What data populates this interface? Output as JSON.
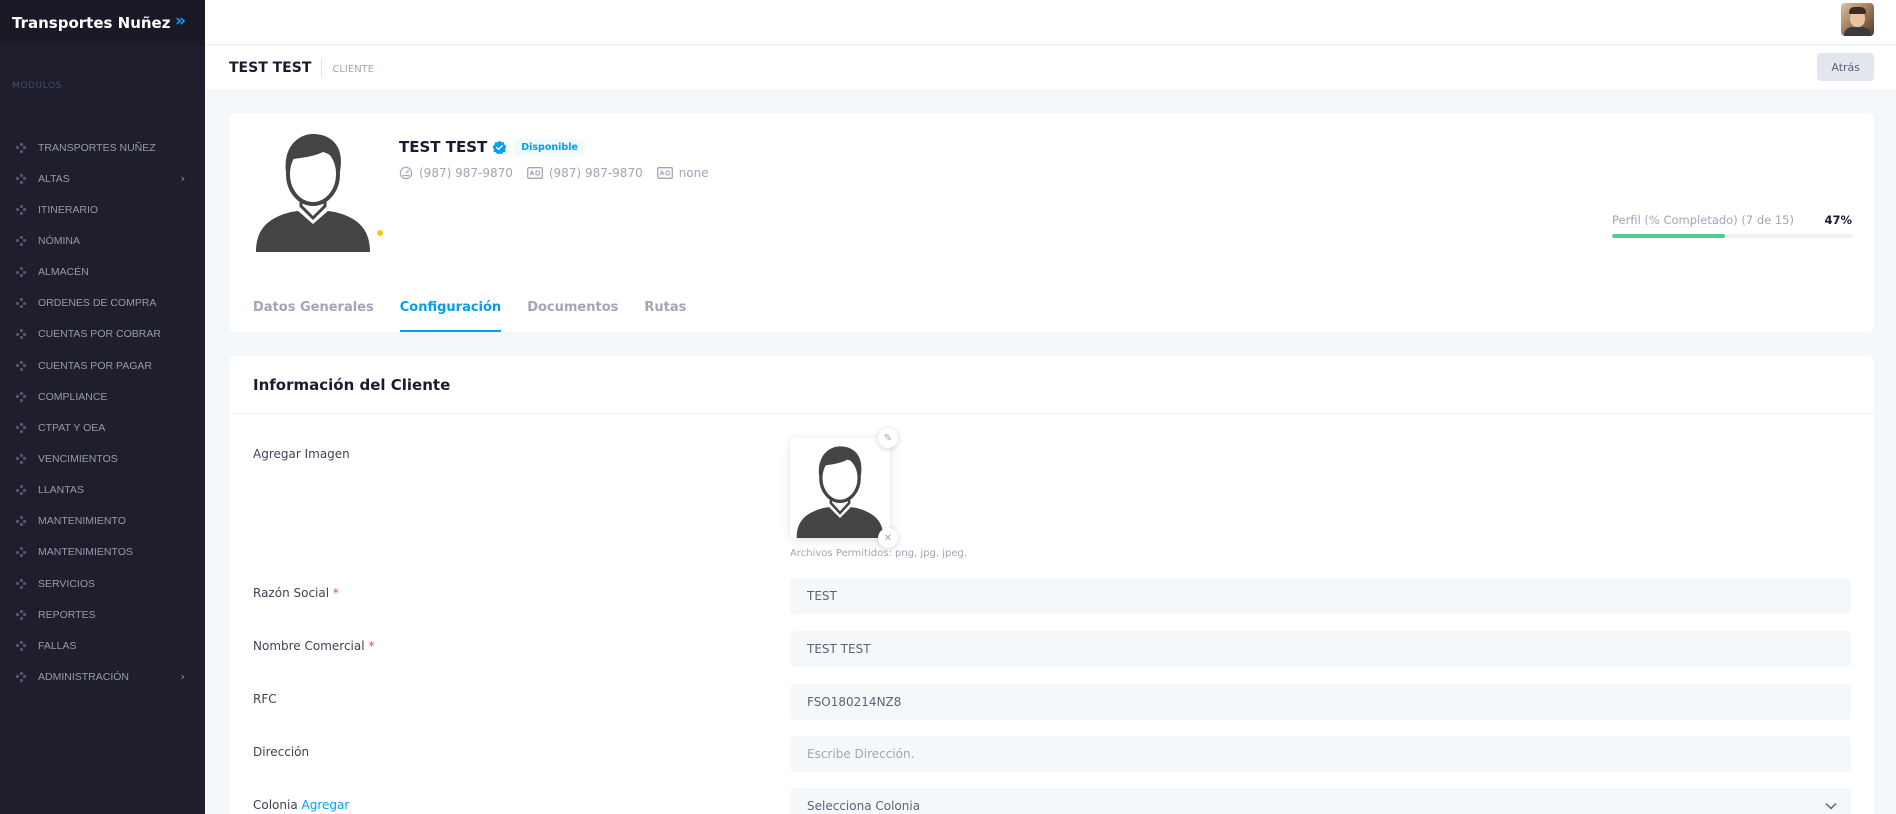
{
  "sidebar": {
    "brand": "Transportes Nuñez",
    "section_label": "MÓDULOS",
    "items": [
      {
        "label": "TRANSPORTES NUÑEZ",
        "has_submenu": false
      },
      {
        "label": "ALTAS",
        "has_submenu": true
      },
      {
        "label": "ITINERARIO",
        "has_submenu": false
      },
      {
        "label": "NÓMINA",
        "has_submenu": false
      },
      {
        "label": "ALMACÉN",
        "has_submenu": false
      },
      {
        "label": "ORDENES DE COMPRA",
        "has_submenu": false
      },
      {
        "label": "CUENTAS POR COBRAR",
        "has_submenu": false
      },
      {
        "label": "CUENTAS POR PAGAR",
        "has_submenu": false
      },
      {
        "label": "COMPLIANCE",
        "has_submenu": false
      },
      {
        "label": "CTPAT Y OEA",
        "has_submenu": false
      },
      {
        "label": "VENCIMIENTOS",
        "has_submenu": false
      },
      {
        "label": "LLANTAS",
        "has_submenu": false
      },
      {
        "label": "MANTENIMIENTO",
        "has_submenu": false
      },
      {
        "label": "MANTENIMIENTOS",
        "has_submenu": false
      },
      {
        "label": "SERVICIOS",
        "has_submenu": false
      },
      {
        "label": "REPORTES",
        "has_submenu": false
      },
      {
        "label": "FALLAS",
        "has_submenu": false
      },
      {
        "label": "ADMINISTRACIÓN",
        "has_submenu": true
      }
    ]
  },
  "subheader": {
    "title": "TEST TEST",
    "breadcrumb": "CLIENTE",
    "back_label": "Atrás"
  },
  "profile": {
    "name": "TEST TEST",
    "status_badge": "Disponible",
    "phone_1": "(987) 987-9870",
    "phone_2": "(987) 987-9870",
    "email": "none",
    "progress_label": "Perfil (% Completado) (7 de 15)",
    "progress_text": "47%",
    "progress_fraction": 0.47,
    "tabs": [
      {
        "label": "Datos Generales",
        "active": false
      },
      {
        "label": "Configuración",
        "active": true
      },
      {
        "label": "Documentos",
        "active": false
      },
      {
        "label": "Rutas",
        "active": false
      }
    ]
  },
  "form": {
    "title": "Información del Cliente",
    "image_label": "Agregar Imagen",
    "image_hint": "Archivos Permitidos: png, jpg, jpeg.",
    "razon_social_label": "Razón Social",
    "razon_social_value": "TEST",
    "nombre_comercial_label": "Nombre Comercial",
    "nombre_comercial_value": "TEST TEST",
    "rfc_label": "RFC",
    "rfc_value": "FSO180214NZ8",
    "direccion_label": "Dirección",
    "direccion_placeholder": "Escribe Dirección.",
    "colonia_label": "Colonia",
    "colonia_link": "Agregar",
    "colonia_placeholder": "Selecciona Colonia",
    "required_mark": "*"
  },
  "colors": {
    "accent": "#009ef7",
    "sidebar_bg": "#1e1e2d",
    "success": "#50cd89",
    "warning": "#ffc700",
    "danger": "#f1416c"
  },
  "icons": {
    "toggle": "double-chevron-right-icon",
    "verified": "verified-badge-icon",
    "phone": "speedometer-icon",
    "id_card": "id-card-icon",
    "edit": "pencil-icon",
    "remove": "close-icon",
    "dropdown": "chevron-down-icon",
    "menu_bullet": "dots-icon"
  }
}
